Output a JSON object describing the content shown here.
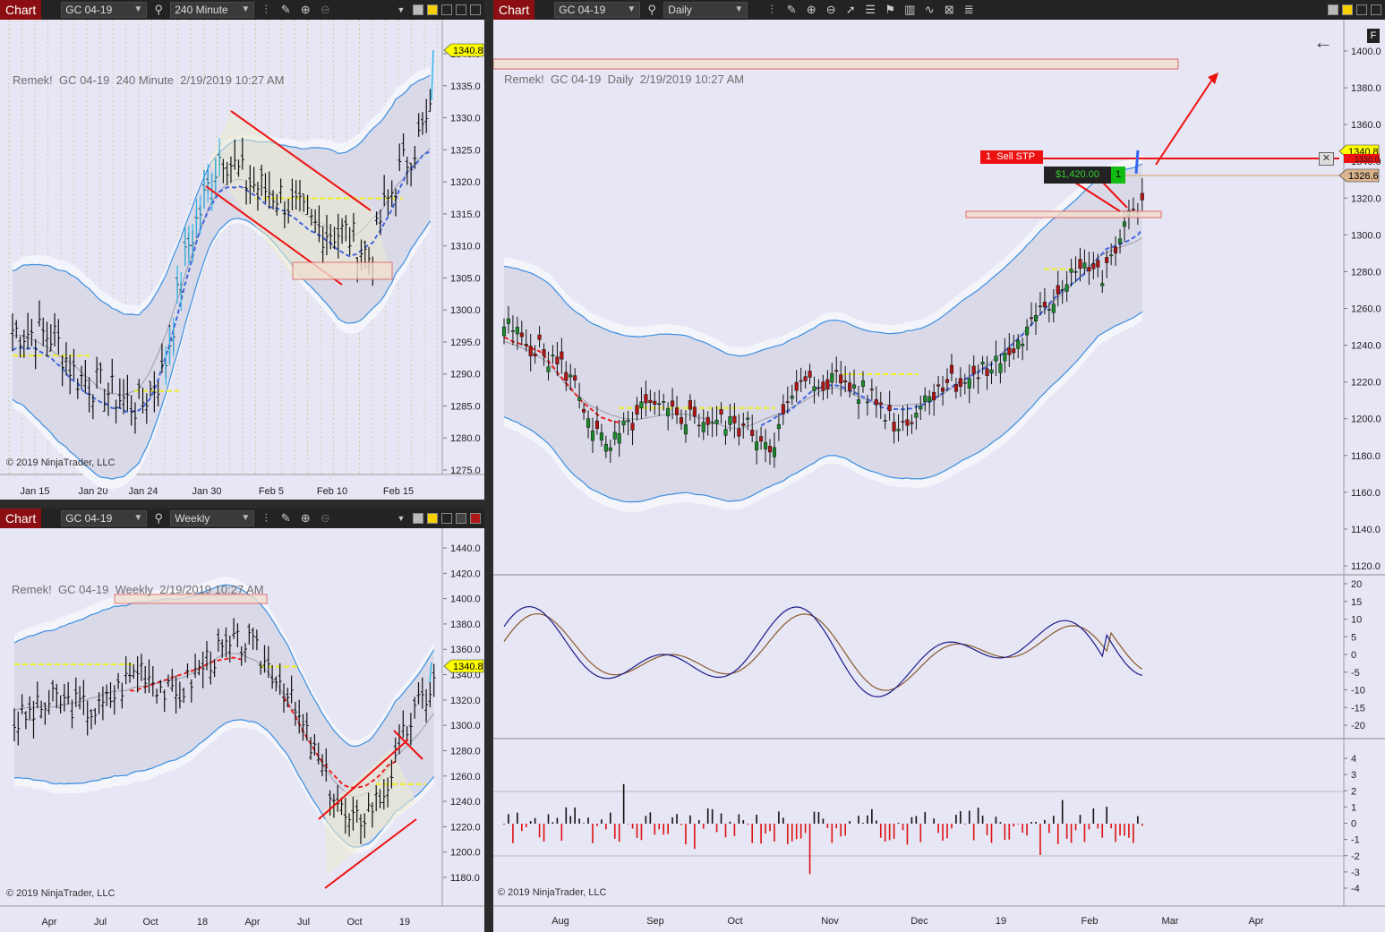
{
  "toolbars": [
    {
      "chart_label": "Chart",
      "instrument": "GC 04-19",
      "period": "240 Minute"
    },
    {
      "chart_label": "Chart",
      "instrument": "GC 04-19",
      "period": "Weekly"
    },
    {
      "chart_label": "Chart",
      "instrument": "GC 04-19",
      "period": "Daily"
    }
  ],
  "icons": [
    "search-icon",
    "bar-type-icon",
    "draw-pencil-icon",
    "zoom-in-icon",
    "zoom-out-icon",
    "pointer-icon",
    "properties-icon",
    "strategies-icon",
    "indicators-icon",
    "template-icon",
    "data-box-icon",
    "color-swatch-icon",
    "tile-window-icon",
    "close-icon"
  ],
  "colors": {
    "background": "#e6e6f5",
    "band_outline": "#3a8fe0",
    "trendline": "#ee1111",
    "level_yellow": "#eeee22",
    "price_tag": "#ffff00",
    "entry_tag": "#d9b48f",
    "sell_stop": "#ee1111",
    "pnl_box": "#222222",
    "pnl_text": "#33cc33",
    "toolbar_red": "#8b0f12"
  },
  "panels": {
    "p240": {
      "overlay": "Remek!  GC 04-19  240 Minute  2/19/2019 10:27 AM",
      "copyright": "© 2019 NinjaTrader, LLC",
      "price_axis": [
        "1340.0",
        "1335.0",
        "1330.0",
        "1325.0",
        "1320.0",
        "1315.0",
        "1310.0",
        "1305.0",
        "1300.0",
        "1295.0",
        "1290.0",
        "1285.0",
        "1280.0",
        "1275.0"
      ],
      "price_tag": "1340.8",
      "time_axis": [
        "Jan 15",
        "Jan 20",
        "Jan 24",
        "Jan 30",
        "Feb 5",
        "Feb 10",
        "Feb 15"
      ]
    },
    "weekly": {
      "overlay": "Remek!  GC 04-19  Weekly  2/19/2019 10:27 AM",
      "copyright": "© 2019 NinjaTrader, LLC",
      "price_axis": [
        "1440.0",
        "1420.0",
        "1400.0",
        "1380.0",
        "1360.0",
        "1340.0",
        "1320.0",
        "1300.0",
        "1280.0",
        "1260.0",
        "1240.0",
        "1220.0",
        "1200.0",
        "1180.0"
      ],
      "price_tag": "1340.8",
      "time_axis": [
        "Apr",
        "Jul",
        "Oct",
        "18",
        "Apr",
        "Jul",
        "Oct",
        "19"
      ]
    },
    "daily": {
      "overlay": "Remek!  GC 04-19  Daily  2/19/2019 10:27 AM",
      "copyright": "© 2019 NinjaTrader, LLC",
      "price_axis": [
        "1400.0",
        "1380.0",
        "1360.0",
        "1340.0",
        "1320.0",
        "1300.0",
        "1280.0",
        "1260.0",
        "1240.0",
        "1220.0",
        "1200.0",
        "1180.0",
        "1160.0",
        "1140.0",
        "1120.0"
      ],
      "price_tag": "1340.8",
      "entry_tag": "1326.6",
      "hidden_tag": "1330.0",
      "order_qty": "1",
      "order_type": "Sell STP",
      "pnl": "$1,420.00",
      "position_qty": "1",
      "f_button": "F",
      "back_arrow": "←",
      "osc_axis": [
        "20",
        "15",
        "10",
        "5",
        "0",
        "-5",
        "-10",
        "-15",
        "-20"
      ],
      "hist_axis": [
        "4",
        "3",
        "2",
        "1",
        "0",
        "-1",
        "-2",
        "-3",
        "-4"
      ],
      "time_axis": [
        "Aug",
        "Sep",
        "Oct",
        "Nov",
        "Dec",
        "19",
        "Feb",
        "Mar",
        "Apr"
      ]
    }
  }
}
